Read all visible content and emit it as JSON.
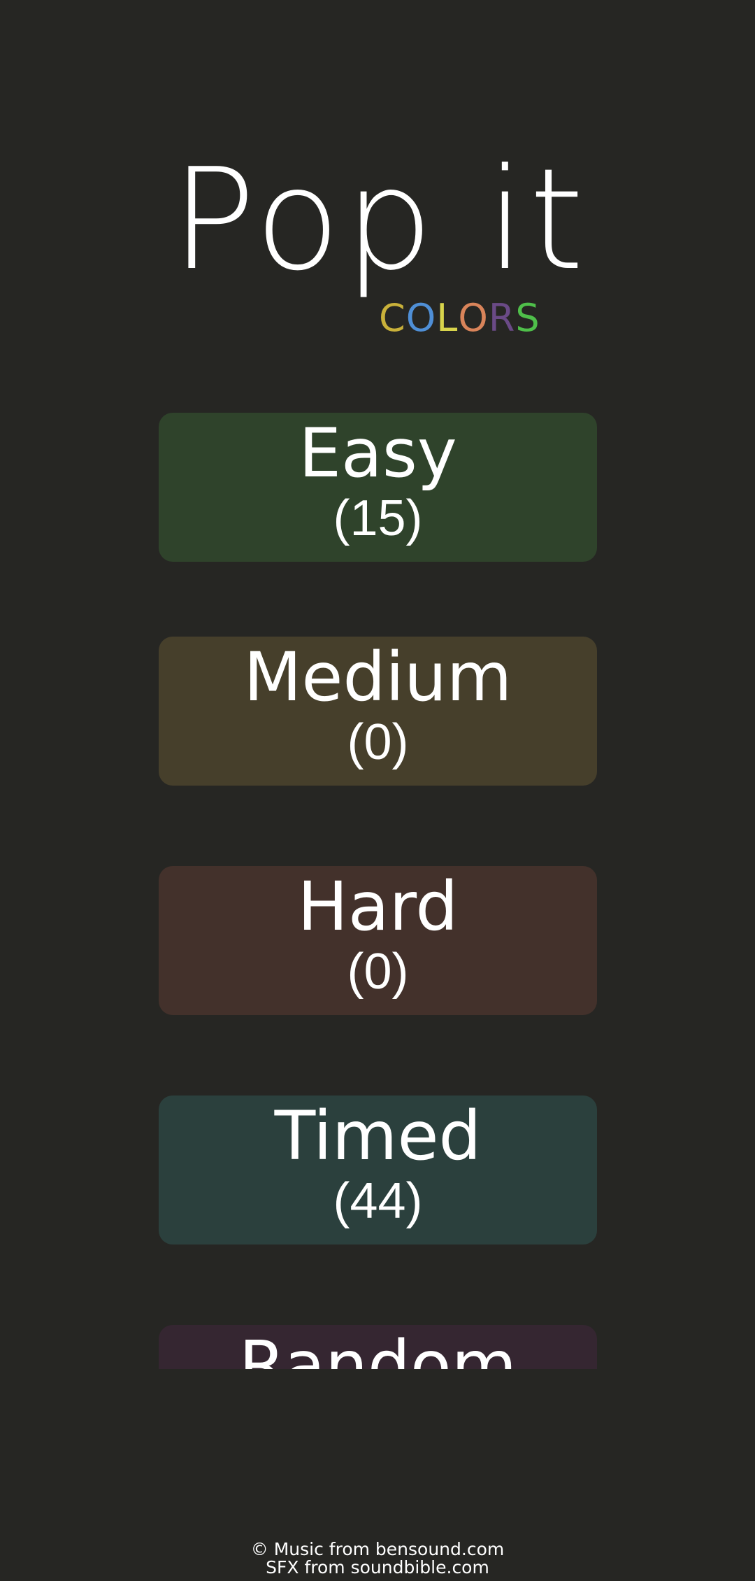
{
  "logo": {
    "title": "Pop it",
    "subtitle_letters": [
      {
        "char": "C",
        "color": "#c9b13a"
      },
      {
        "char": "O",
        "color": "#4f8fd6"
      },
      {
        "char": "L",
        "color": "#d8d44c"
      },
      {
        "char": "O",
        "color": "#d9845a"
      },
      {
        "char": "R",
        "color": "#6a4a86"
      },
      {
        "char": "S",
        "color": "#4fbf4a"
      }
    ]
  },
  "modes": [
    {
      "name": "Easy",
      "count": "(15)",
      "color": "#2f432b"
    },
    {
      "name": "Medium",
      "count": "(0)",
      "color": "#463f2b"
    },
    {
      "name": "Hard",
      "count": "(0)",
      "color": "#43312b"
    },
    {
      "name": "Timed",
      "count": "(44)",
      "color": "#2b403d"
    },
    {
      "name": "Random",
      "count": "",
      "color": "#352631"
    }
  ],
  "credits": {
    "line1": "© Music from bensound.com",
    "line2": "SFX from soundbible.com"
  }
}
